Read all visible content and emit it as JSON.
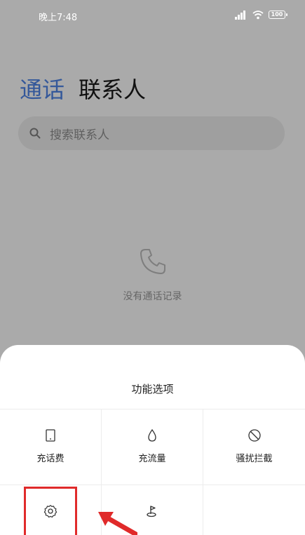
{
  "status_bar": {
    "time": "晚上7:48",
    "battery": "100"
  },
  "tabs": [
    {
      "label": "通话",
      "active": true
    },
    {
      "label": "联系人",
      "active": false
    }
  ],
  "search": {
    "placeholder": "搜索联系人"
  },
  "empty_state": {
    "text": "没有通话记录"
  },
  "sheet": {
    "title": "功能选项",
    "items": [
      {
        "label": "充话费",
        "icon": "phone-icon"
      },
      {
        "label": "充流量",
        "icon": "drop-icon"
      },
      {
        "label": "骚扰拦截",
        "icon": "block-icon"
      },
      {
        "label": "",
        "icon": "settings-icon"
      },
      {
        "label": "",
        "icon": "location-icon"
      }
    ]
  },
  "colors": {
    "accent": "#34589a",
    "overlay": "#aaaaaa",
    "highlight": "#e02a2a"
  }
}
